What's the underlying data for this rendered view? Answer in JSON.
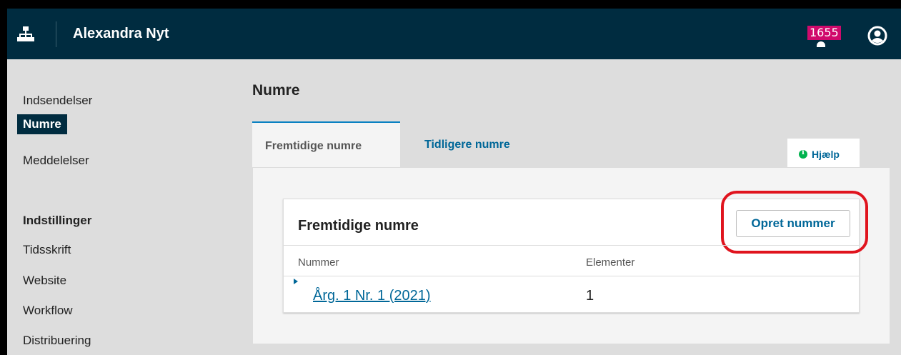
{
  "header": {
    "site_title": "Alexandra Nyt",
    "notification_count": "1655",
    "icons": {
      "sitemap": "sitemap-icon",
      "notifications": "bell-icon",
      "user": "user-icon"
    },
    "colors": {
      "bar": "#002c40",
      "badge": "#d00a6c"
    }
  },
  "sidebar": {
    "items": [
      {
        "label": "Indsendelser",
        "active": false
      },
      {
        "label": "Numre",
        "active": true
      },
      {
        "label": "Meddelelser",
        "active": false
      }
    ],
    "settings_heading": "Indstillinger",
    "settings_items": [
      {
        "label": "Tidsskrift"
      },
      {
        "label": "Website"
      },
      {
        "label": "Workflow"
      },
      {
        "label": "Distribuering"
      }
    ]
  },
  "main": {
    "page_title": "Numre",
    "tabs": [
      {
        "label": "Fremtidige numre",
        "active": true
      },
      {
        "label": "Tidligere numre",
        "active": false
      }
    ],
    "help_label": "Hjælp",
    "grid": {
      "title": "Fremtidige numre",
      "create_button": "Opret nummer",
      "columns": [
        "Nummer",
        "Elementer"
      ],
      "rows": [
        {
          "issue": "Årg. 1 Nr. 1 (2021)",
          "items": "1"
        }
      ]
    },
    "colors": {
      "link": "#006798",
      "highlight": "#e0141e",
      "help": "#00b24e"
    }
  }
}
